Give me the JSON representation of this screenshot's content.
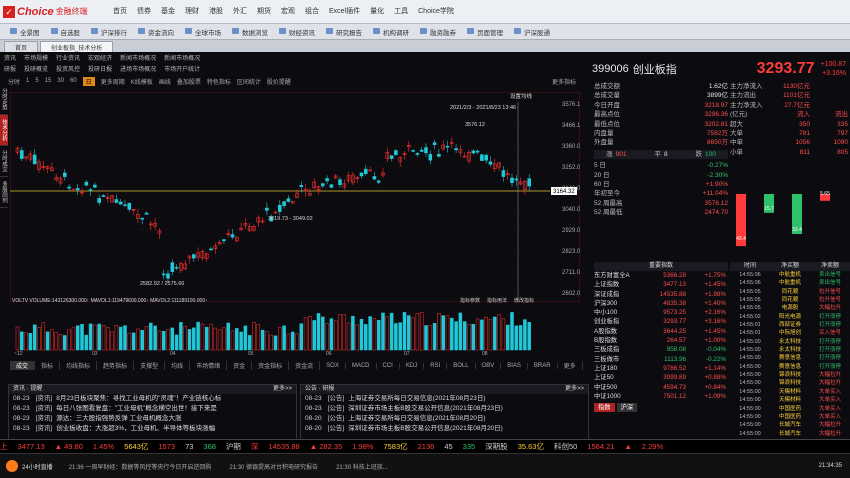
{
  "app": {
    "brand": "Choice",
    "brand_sub": "金融终端",
    "menu": [
      "首页",
      "债券",
      "基金",
      "理财",
      "港股",
      "外汇",
      "期货",
      "宏观",
      "组合",
      "Excel插件",
      "量化",
      "工具",
      "Choice学院"
    ]
  },
  "toolbar": [
    "全景图",
    "自选股",
    "沪深排行",
    "资金流向",
    "全球市场",
    "数据浏览",
    "财经资讯",
    "研究报告",
    "机构调研",
    "融资融券",
    "页面管理",
    "沪深股通"
  ],
  "tabs": [
    "首页",
    "创业板指_技术分析"
  ],
  "nav_row1": [
    "资讯",
    "市场规模",
    "行业资讯",
    "宏观经济",
    "新闻市场概况",
    "新闻市场概况"
  ],
  "nav_row2": [
    "研报",
    "投研概览",
    "投资风控",
    "投研日报",
    "进场市场概况",
    "市场开户统计"
  ],
  "chart_ctrl": {
    "periods": [
      "分时",
      "1",
      "5",
      "15",
      "30",
      "60"
    ],
    "selected": "日",
    "rest": [
      "更多周期",
      "K线模板",
      "画线",
      "叠加股票",
      "特色指标",
      "区间统计",
      "股价提醒"
    ],
    "right_label": "更多指标"
  },
  "side_tabs": [
    "分时走势",
    "技术分析",
    "分时成交",
    "多股同列"
  ],
  "ohlc_box": {
    "date": "2021/2/3 - 2021/8/23 13:46",
    "label": "设置均线"
  },
  "price_axis": [
    "3576.12",
    "3466.10",
    "3360.00",
    "3252.00",
    "3146.00",
    "3040.00",
    "2929.00",
    "2823.00",
    "2711.00",
    "2602.00"
  ],
  "price_marks": {
    "current": "3164.32",
    "annotate1": "3576.12",
    "annotate2": "3019.73 - 3049.02",
    "annotate3": "2582.92 / 2575.66"
  },
  "volume_header": "VOLTV  VOLUME:143126300.000↑  MAVOL1:119479600.000↑  MAVOL2:111189100.000↑",
  "volume_tools": [
    "指标参数",
    "指标用法",
    "修改指标"
  ],
  "xaxis": [
    "~12",
    "03",
    "04",
    "05",
    "06",
    "07",
    "08"
  ],
  "indicator_tabs": [
    "成交",
    "指标",
    "均线指标",
    "趋势指标",
    "支撑型",
    "均线",
    "市场情绪",
    "资金",
    "资金指标",
    "资金流",
    "SOX",
    "MACD",
    "CCI",
    "KDJ",
    "RSI",
    "BOLL",
    "OBV",
    "BIAS",
    "BRAR",
    "更多"
  ],
  "news": {
    "left_tab": "资讯",
    "left_tab2": "提醒",
    "more": "更多>>",
    "left": [
      {
        "date": "08-23",
        "tag": "[资讯]",
        "text": "8月23日板块聚焦：寻找工业母机的\"灵魂\"！产业链核心标"
      },
      {
        "date": "08-23",
        "tag": "[资讯]",
        "text": "每日八张图看复盘：\"工业母机\"概念横空出世！接下来是"
      },
      {
        "date": "08-23",
        "tag": "[资讯]",
        "text": "源达：三大股指强势反弹 工业母机概念大涨"
      },
      {
        "date": "08-23",
        "tag": "[资讯]",
        "text": "创业板收盘：大涨超3%，工业母机、半导体等板块涨幅"
      }
    ],
    "right_tab": "公告",
    "right_tab2": "研报",
    "right": [
      {
        "date": "08-23",
        "tag": "[公告]",
        "text": "上海证券交易所每日交易信息(2021年08月23日)"
      },
      {
        "date": "08-23",
        "tag": "[公告]",
        "text": "深圳证券市场主板B股交易公开信息(2021年08月23日)"
      },
      {
        "date": "08-20",
        "tag": "[公告]",
        "text": "上海证券交易所每日交易信息(2021年08月20日)"
      },
      {
        "date": "08-20",
        "tag": "[公告]",
        "text": "深圳证券市场主板B股交易公开信息(2021年08月20日)"
      }
    ]
  },
  "quote": {
    "code": "399006",
    "name": "创业板指",
    "price": "3293.77",
    "change": "+100.87",
    "pct": "+3.16%",
    "rows": [
      {
        "l": "总成交额",
        "v": "1.62亿",
        "c": "w"
      },
      {
        "l": "总成交量",
        "v": "3899亿",
        "c": "w"
      },
      {
        "l": "今日开盘",
        "v": "3218.97",
        "c": "r"
      },
      {
        "l": "最高点位",
        "v": "3296.36",
        "c": "r"
      },
      {
        "l": "最低点位",
        "v": "3202.81",
        "c": "r"
      },
      {
        "l": "内盘量",
        "v": "7582万",
        "c": "r"
      },
      {
        "l": "外盘量",
        "v": "8650万",
        "c": "r"
      }
    ],
    "updown": [
      {
        "l": "涨",
        "v": "901"
      },
      {
        "l": "平",
        "v": "8"
      },
      {
        "l": "跌",
        "v": "100"
      }
    ],
    "perf": [
      {
        "l": "5 日",
        "v": "-0.27%",
        "c": "g"
      },
      {
        "l": "20 日",
        "v": "-2.30%",
        "c": "g"
      },
      {
        "l": "60 日",
        "v": "+1.90%",
        "c": "r"
      },
      {
        "l": "年初至今",
        "v": "+11.04%",
        "c": "r"
      },
      {
        "l": "52 周最高",
        "v": "3576.12",
        "c": "r"
      },
      {
        "l": "52 周最低",
        "v": "2474.70",
        "c": "r"
      }
    ]
  },
  "fund_flow": {
    "rows": [
      {
        "l": "主力净流入",
        "a": "1130亿元",
        "b": ""
      },
      {
        "l": "主力流出",
        "a": "1101亿元",
        "b": ""
      },
      {
        "l": "主力净流入",
        "a": "27.7亿元",
        "b": ""
      },
      {
        "l": "(亿元)",
        "a": "流入",
        "b": "流出"
      },
      {
        "l": "超大",
        "a": "350",
        "b": "335"
      },
      {
        "l": "大单",
        "a": "781",
        "b": "797"
      },
      {
        "l": "中单",
        "a": "1056",
        "b": "1090"
      },
      {
        "l": "小单",
        "a": "811",
        "b": "805"
      }
    ],
    "bars": [
      {
        "v": 43.4,
        "label": "43.4",
        "c": "#ff3b3b"
      },
      {
        "v": -15.7,
        "label": "15.7",
        "c": "#2ec06a"
      },
      {
        "v": -33.4,
        "label": "33.4",
        "c": "#2ec06a"
      },
      {
        "v": 5.65,
        "label": "5.65",
        "c": "#ff3b3b"
      }
    ]
  },
  "index_list": {
    "title": "重要指数",
    "rows": [
      {
        "n": "东方财富全A",
        "p": "5366.28",
        "c": "+1.75%",
        "g": false
      },
      {
        "n": "上证指数",
        "p": "3477.13",
        "c": "+1.45%",
        "g": false
      },
      {
        "n": "深证成指",
        "p": "14535.88",
        "c": "+1.98%",
        "g": false
      },
      {
        "n": "沪深300",
        "p": "4835.38",
        "c": "+1.40%",
        "g": false
      },
      {
        "n": "中小100",
        "p": "9573.25",
        "c": "+2.16%",
        "g": false
      },
      {
        "n": "创业板指",
        "p": "3293.77",
        "c": "+3.16%",
        "g": false
      },
      {
        "n": "A股指数",
        "p": "3644.25",
        "c": "+1.45%",
        "g": false
      },
      {
        "n": "B股指数",
        "p": "264.57",
        "c": "+1.00%",
        "g": false
      },
      {
        "n": "三板成指",
        "p": "958.08",
        "c": "-0.04%",
        "g": true
      },
      {
        "n": "三板做市",
        "p": "1113.96",
        "c": "-0.22%",
        "g": true
      },
      {
        "n": "上证180",
        "p": "9786.52",
        "c": "+1.14%",
        "g": false
      },
      {
        "n": "上证50",
        "p": "3099.89",
        "c": "+0.88%",
        "g": false
      },
      {
        "n": "中证500",
        "p": "4594.73",
        "c": "+0.84%",
        "g": false
      },
      {
        "n": "中证1000",
        "p": "7501.12",
        "c": "+1.09%",
        "g": false
      }
    ],
    "footer": [
      "指数",
      "沪深"
    ]
  },
  "tick_list": {
    "headers": [
      "时间",
      "净买额",
      "净卖额"
    ],
    "rows": [
      [
        "14:55:06",
        "中航重机",
        "卖出信号"
      ],
      [
        "14:55:06",
        "中航重机",
        "卖出信号"
      ],
      [
        "14:55:05",
        "同花顺",
        "拉升信号"
      ],
      [
        "14:55:05",
        "同花顺",
        "拉升信号"
      ],
      [
        "14:55:05",
        "电源股",
        "大幅拉升"
      ],
      [
        "14:55:02",
        "阳光电源",
        "打开涨停"
      ],
      [
        "14:55:01",
        "西部证券",
        "打开涨停"
      ],
      [
        "14:55:01",
        "中际旭创",
        "买入信号"
      ],
      [
        "14:55:00",
        "永太科技",
        "打开涨停"
      ],
      [
        "14:55:00",
        "永太科技",
        "打开涨停"
      ],
      [
        "14:55:00",
        "赛意信息",
        "打开涨停"
      ],
      [
        "14:55:00",
        "赛意信息",
        "打开涨停"
      ],
      [
        "14:55:00",
        "锦浪科技",
        "大幅拉升"
      ],
      [
        "14:55:00",
        "锦浪科技",
        "大幅拉升"
      ],
      [
        "14:55:00",
        "天赐材料",
        "大单买入"
      ],
      [
        "14:55:00",
        "天赐材料",
        "大单买入"
      ],
      [
        "14:55:00",
        "中国医药",
        "大单买入"
      ],
      [
        "14:55:00",
        "中国医药",
        "大单买入"
      ],
      [
        "14:55:00",
        "长城汽车",
        "大幅拉升"
      ],
      [
        "14:55:00",
        "长城汽车",
        "大幅拉升"
      ]
    ]
  },
  "ticker": [
    {
      "t": "上",
      "c": "#ff3b3b"
    },
    {
      "t": "3477.13",
      "c": "#ff3b3b"
    },
    {
      "t": "▲ 49.80",
      "c": "#ff3b3b"
    },
    {
      "t": "1.45%",
      "c": "#ff3b3b"
    },
    {
      "t": "5643亿",
      "c": "#ffd23b"
    },
    {
      "t": "1573",
      "c": "#ff3b3b"
    },
    {
      "t": "73",
      "c": "#cccccc"
    },
    {
      "t": "368",
      "c": "#2ec06a"
    },
    {
      "t": "沪期",
      "c": "#cccccc"
    },
    {
      "t": "深",
      "c": "#ff3b3b"
    },
    {
      "t": "14535.88",
      "c": "#ff3b3b"
    },
    {
      "t": "▲ 282.35",
      "c": "#ff3b3b"
    },
    {
      "t": "1.98%",
      "c": "#ff3b3b"
    },
    {
      "t": "7583亿",
      "c": "#ffd23b"
    },
    {
      "t": "2136",
      "c": "#ff3b3b"
    },
    {
      "t": "45",
      "c": "#cccccc"
    },
    {
      "t": "335",
      "c": "#2ec06a"
    },
    {
      "t": "深期股",
      "c": "#cccccc"
    },
    {
      "t": "35.63亿",
      "c": "#ffd23b"
    },
    {
      "t": "科创50",
      "c": "#cccccc"
    },
    {
      "t": "1564.21",
      "c": "#ff3b3b"
    },
    {
      "t": "▲",
      "c": "#ff3b3b"
    },
    {
      "t": "2.29%",
      "c": "#ff3b3b"
    }
  ],
  "status": {
    "left": "24小时直播",
    "msgs": [
      "21:36 一周早财经：数据等风控等央行今日开启逆回购",
      "21:30 德银提高对台积电研究报告",
      "21:30 科技上班族..."
    ],
    "time": "21:34:35"
  }
}
